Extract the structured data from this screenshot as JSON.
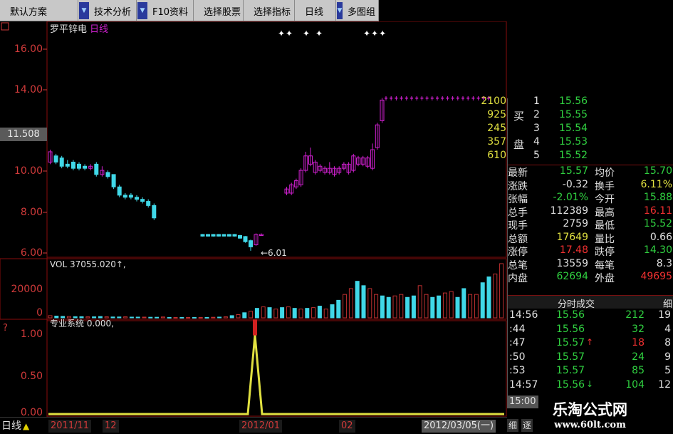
{
  "toolbar": {
    "items": [
      {
        "label": "默认方案",
        "arrow": false
      },
      {
        "label": "技术分析",
        "arrow": true
      },
      {
        "label": "F10资料",
        "arrow": true
      },
      {
        "label": "选择股票",
        "arrow": false
      },
      {
        "label": "选择指标",
        "arrow": false
      },
      {
        "label": "日线",
        "arrow": false
      },
      {
        "label": "多图组",
        "arrow": true
      }
    ]
  },
  "chart_header": {
    "stock_name": "罗平锌电",
    "period": "日线"
  },
  "price_axis": {
    "ticks": [
      "16.00",
      "14.00",
      "10.00",
      "8.00",
      "6.00"
    ],
    "current": "11.508"
  },
  "low_marker": "←6.01",
  "volume": {
    "label": "VOL 37055.020↑,",
    "ticks": [
      "20000",
      "0"
    ]
  },
  "indicator": {
    "label": "专业系统 0.000,",
    "ticks": [
      "1.00",
      "0.50",
      "0.00"
    ]
  },
  "bottom": {
    "period_tab": "日线",
    "dates": [
      "2011/11",
      "12",
      "2012/01",
      "02"
    ],
    "current_date": "2012/03/05(一)",
    "buttons": [
      "细",
      "逐"
    ]
  },
  "order_book": {
    "side_label": [
      "买",
      "盘"
    ],
    "rows": [
      {
        "level": "1",
        "price": "15.56",
        "vol": "2100"
      },
      {
        "level": "2",
        "price": "15.55",
        "vol": "925"
      },
      {
        "level": "3",
        "price": "15.54",
        "vol": "245"
      },
      {
        "level": "4",
        "price": "15.53",
        "vol": "357"
      },
      {
        "level": "5",
        "price": "15.52",
        "vol": "610"
      }
    ]
  },
  "quote": [
    {
      "k1": "最新",
      "v1": "15.57",
      "c1": "green",
      "k2": "均价",
      "v2": "15.70",
      "c2": "green"
    },
    {
      "k1": "涨跌",
      "v1": "-0.32",
      "c1": "white",
      "k2": "换手",
      "v2": "6.11%",
      "c2": "yellow"
    },
    {
      "k1": "张幅",
      "v1": "-2.01%",
      "c1": "green",
      "k2": "今开",
      "v2": "15.88",
      "c2": "green"
    },
    {
      "k1": "总手",
      "v1": "112389",
      "c1": "white",
      "k2": "最高",
      "v2": "16.11",
      "c2": "red"
    },
    {
      "k1": "现手",
      "v1": "2759",
      "c1": "white",
      "k2": "最低",
      "v2": "15.52",
      "c2": "green"
    },
    {
      "k1": "总额",
      "v1": "17649",
      "c1": "yellow",
      "k2": "量比",
      "v2": "0.66",
      "c2": "white"
    },
    {
      "k1": "涨停",
      "v1": "17.48",
      "c1": "red",
      "k2": "跌停",
      "v2": "14.30",
      "c2": "green"
    },
    {
      "k1": "总笔",
      "v1": "13559",
      "c1": "white",
      "k2": "每笔",
      "v2": "8.3",
      "c2": "white"
    },
    {
      "k1": "内盘",
      "v1": "62694",
      "c1": "green",
      "k2": "外盘",
      "v2": "49695",
      "c2": "red"
    }
  ],
  "ticks_panel": {
    "title": "分时成交",
    "tab": "细",
    "rows": [
      {
        "time": "14:56",
        "price": "15.56",
        "arrow": "",
        "vol": "212",
        "vcolor": "green",
        "count": "19"
      },
      {
        "time": ":44",
        "price": "15.56",
        "arrow": "",
        "vol": "32",
        "vcolor": "green",
        "count": "4"
      },
      {
        "time": ":47",
        "price": "15.57",
        "arrow": "↑",
        "vol": "18",
        "vcolor": "red",
        "count": "8"
      },
      {
        "time": ":50",
        "price": "15.57",
        "arrow": "",
        "vol": "24",
        "vcolor": "green",
        "count": "9"
      },
      {
        "time": ":53",
        "price": "15.57",
        "arrow": "",
        "vol": "85",
        "vcolor": "green",
        "count": "5"
      },
      {
        "time": "14:57",
        "price": "15.56",
        "arrow": "↓",
        "vol": "104",
        "vcolor": "green",
        "count": "12"
      }
    ],
    "footer": "15:00"
  },
  "watermark": {
    "title": "乐淘公式网",
    "url": "www.60lt.com"
  },
  "colors": {
    "up": "#d020d0",
    "down": "#40d8e8",
    "vol_up": "#c03030",
    "vol_down": "#40d8e8",
    "signal": "#e0e040",
    "signal_top": "#d02020"
  },
  "chart_data": {
    "type": "candlestick",
    "title": "罗平锌电 日线",
    "ylim": [
      5.8,
      16.9
    ],
    "x_labels": [
      "2011/11",
      "12",
      "2012/01",
      "02"
    ],
    "candles": [
      {
        "o": 10.3,
        "c": 10.8,
        "h": 10.9,
        "l": 10.2,
        "up": true
      },
      {
        "o": 10.6,
        "c": 10.3,
        "h": 10.7,
        "l": 10.2,
        "up": false
      },
      {
        "o": 10.5,
        "c": 10.1,
        "h": 10.6,
        "l": 10.0,
        "up": false
      },
      {
        "o": 10.2,
        "c": 10.1,
        "h": 10.4,
        "l": 10.0,
        "up": false
      },
      {
        "o": 10.3,
        "c": 10.0,
        "h": 10.4,
        "l": 9.9,
        "up": false
      },
      {
        "o": 10.2,
        "c": 10.0,
        "h": 10.3,
        "l": 9.9,
        "up": false
      },
      {
        "o": 10.1,
        "c": 10.0,
        "h": 10.2,
        "l": 9.9,
        "up": false
      },
      {
        "o": 10.0,
        "c": 10.1,
        "h": 10.2,
        "l": 9.9,
        "up": true
      },
      {
        "o": 10.2,
        "c": 9.7,
        "h": 10.3,
        "l": 9.6,
        "up": false
      },
      {
        "o": 9.7,
        "c": 9.9,
        "h": 10.1,
        "l": 9.6,
        "up": true
      },
      {
        "o": 9.8,
        "c": 9.6,
        "h": 9.9,
        "l": 9.5,
        "up": false
      },
      {
        "o": 9.7,
        "c": 9.1,
        "h": 9.7,
        "l": 9.0,
        "up": false
      },
      {
        "o": 9.1,
        "c": 8.7,
        "h": 9.2,
        "l": 8.6,
        "up": false
      },
      {
        "o": 8.7,
        "c": 8.6,
        "h": 8.8,
        "l": 8.5,
        "up": false
      },
      {
        "o": 8.7,
        "c": 8.6,
        "h": 8.8,
        "l": 8.5,
        "up": false
      },
      {
        "o": 8.6,
        "c": 8.5,
        "h": 8.7,
        "l": 8.4,
        "up": false
      },
      {
        "o": 8.5,
        "c": 8.4,
        "h": 8.6,
        "l": 8.3,
        "up": false
      },
      {
        "o": 8.4,
        "c": 8.2,
        "h": 8.5,
        "l": 8.1,
        "up": false
      },
      {
        "o": 8.2,
        "c": 7.6,
        "h": 8.3,
        "l": 7.5,
        "up": false
      },
      {
        "o": 6.8,
        "c": 6.72,
        "h": 6.82,
        "l": 6.7,
        "up": false
      },
      {
        "o": 6.8,
        "c": 6.72,
        "h": 6.82,
        "l": 6.7,
        "up": false
      },
      {
        "o": 6.8,
        "c": 6.72,
        "h": 6.82,
        "l": 6.7,
        "up": false
      },
      {
        "o": 6.8,
        "c": 6.72,
        "h": 6.82,
        "l": 6.7,
        "up": false
      },
      {
        "o": 6.8,
        "c": 6.72,
        "h": 6.82,
        "l": 6.7,
        "up": false
      },
      {
        "o": 6.8,
        "c": 6.72,
        "h": 6.82,
        "l": 6.7,
        "up": false
      },
      {
        "o": 6.8,
        "c": 6.72,
        "h": 6.82,
        "l": 6.7,
        "up": false
      },
      {
        "o": 6.75,
        "c": 6.62,
        "h": 6.78,
        "l": 6.6,
        "up": false
      },
      {
        "o": 6.7,
        "c": 6.45,
        "h": 6.72,
        "l": 6.4,
        "up": false
      },
      {
        "o": 6.5,
        "c": 6.2,
        "h": 6.55,
        "l": 6.01,
        "up": false
      },
      {
        "o": 6.3,
        "c": 6.8,
        "h": 6.85,
        "l": 6.25,
        "up": true
      },
      {
        "o": 6.8,
        "c": 6.78,
        "h": 6.85,
        "l": 6.75,
        "up": true
      },
      {
        "o": 9.0,
        "c": 8.8,
        "h": 9.1,
        "l": 8.7,
        "up": true
      },
      {
        "o": 8.8,
        "c": 9.2,
        "h": 9.3,
        "l": 8.7,
        "up": true
      },
      {
        "o": 9.1,
        "c": 9.4,
        "h": 9.5,
        "l": 9.0,
        "up": true
      },
      {
        "o": 9.2,
        "c": 9.9,
        "h": 10.0,
        "l": 9.1,
        "up": true
      },
      {
        "o": 9.9,
        "c": 10.6,
        "h": 10.8,
        "l": 9.8,
        "up": true
      },
      {
        "o": 10.2,
        "c": 10.6,
        "h": 11.0,
        "l": 10.1,
        "up": true
      },
      {
        "o": 10.3,
        "c": 9.8,
        "h": 10.4,
        "l": 9.7,
        "up": true
      },
      {
        "o": 9.9,
        "c": 10.1,
        "h": 10.2,
        "l": 9.8,
        "up": true
      },
      {
        "o": 10.0,
        "c": 9.8,
        "h": 10.1,
        "l": 9.7,
        "up": true
      },
      {
        "o": 9.8,
        "c": 10.0,
        "h": 10.3,
        "l": 9.7,
        "up": true
      },
      {
        "o": 10.0,
        "c": 9.7,
        "h": 10.1,
        "l": 9.6,
        "up": true
      },
      {
        "o": 9.8,
        "c": 10.0,
        "h": 10.1,
        "l": 9.7,
        "up": true
      },
      {
        "o": 10.0,
        "c": 10.2,
        "h": 10.3,
        "l": 9.9,
        "up": true
      },
      {
        "o": 10.2,
        "c": 9.8,
        "h": 10.3,
        "l": 9.7,
        "up": true
      },
      {
        "o": 9.9,
        "c": 10.6,
        "h": 10.7,
        "l": 9.8,
        "up": true
      },
      {
        "o": 10.5,
        "c": 10.2,
        "h": 10.6,
        "l": 10.1,
        "up": true
      },
      {
        "o": 10.2,
        "c": 10.5,
        "h": 10.6,
        "l": 10.1,
        "up": true
      },
      {
        "o": 10.5,
        "c": 10.1,
        "h": 10.6,
        "l": 10.0,
        "up": true
      },
      {
        "o": 10.0,
        "c": 10.9,
        "h": 11.2,
        "l": 9.9,
        "up": true
      },
      {
        "o": 11.0,
        "c": 12.1,
        "h": 12.2,
        "l": 10.9,
        "up": true
      },
      {
        "o": 12.3,
        "c": 13.3,
        "h": 13.4,
        "l": 12.2,
        "up": true
      }
    ],
    "volume": [
      1500,
      1200,
      1000,
      900,
      800,
      800,
      700,
      700,
      900,
      700,
      600,
      600,
      700,
      500,
      500,
      500,
      400,
      400,
      600,
      300,
      300,
      300,
      300,
      300,
      300,
      300,
      400,
      500,
      700,
      1500,
      2200,
      3500,
      4500,
      6500,
      7500,
      7000,
      6000,
      7000,
      7500,
      6500,
      6000,
      6500,
      7000,
      8000,
      6000,
      9000,
      12000,
      16000,
      20000,
      25000,
      22000,
      20000,
      16000,
      15000,
      14000,
      15000,
      16000,
      14000,
      15000,
      22000,
      16000,
      14000,
      15000,
      17000,
      18000,
      14000,
      20000,
      16000,
      16000,
      24000,
      28000,
      30000,
      37055
    ],
    "volume_ylim": [
      0,
      38000
    ],
    "signal": {
      "peak_index": 14,
      "peak_value": 1.0,
      "ylim": [
        0,
        1.15
      ]
    }
  }
}
